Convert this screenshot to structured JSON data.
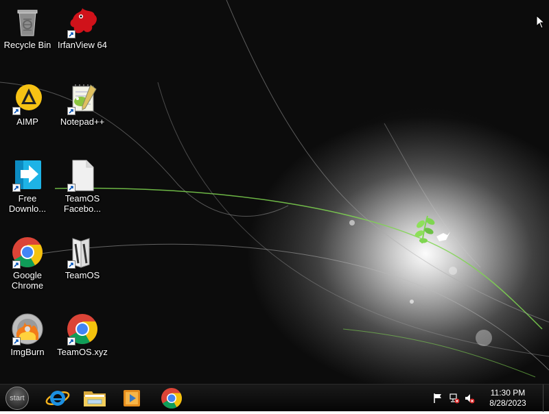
{
  "desktop": {
    "icons": [
      {
        "label": "Recycle Bin",
        "icon": "recycle-bin-icon",
        "shortcut": false
      },
      {
        "label": "IrfanView 64",
        "icon": "irfanview-icon",
        "shortcut": true
      },
      {
        "label": "AIMP",
        "icon": "aimp-icon",
        "shortcut": true
      },
      {
        "label": "Notepad++",
        "icon": "notepadpp-icon",
        "shortcut": true
      },
      {
        "label": "Free Downlo...",
        "icon": "free-download-manager-icon",
        "shortcut": true
      },
      {
        "label": "TeamOS Facebo...",
        "icon": "file-icon",
        "shortcut": true
      },
      {
        "label": "Google Chrome",
        "icon": "chrome-icon",
        "shortcut": true
      },
      {
        "label": "TeamOS",
        "icon": "teamos-folder-icon",
        "shortcut": true
      },
      {
        "label": "ImgBurn",
        "icon": "imgburn-icon",
        "shortcut": true
      },
      {
        "label": "TeamOS.xyz",
        "icon": "chrome-icon",
        "shortcut": true
      }
    ]
  },
  "taskbar": {
    "start_label": "start",
    "pinned": [
      {
        "name": "Internet Explorer",
        "icon": "internet-explorer-icon"
      },
      {
        "name": "File Explorer",
        "icon": "folder-icon"
      },
      {
        "name": "Media Player",
        "icon": "media-player-icon"
      },
      {
        "name": "Google Chrome",
        "icon": "chrome-icon"
      }
    ],
    "tray": {
      "icons": [
        "action-center-flag-icon",
        "network-disconnected-icon",
        "volume-muted-icon"
      ],
      "time": "11:30 PM",
      "date": "8/28/2023"
    }
  },
  "colors": {
    "taskbar": "#0a0a0a",
    "accent_green": "#7fd650",
    "chrome_red": "#db4437",
    "chrome_yellow": "#f4c20d",
    "chrome_green": "#0f9d58",
    "chrome_blue": "#4285f4"
  }
}
